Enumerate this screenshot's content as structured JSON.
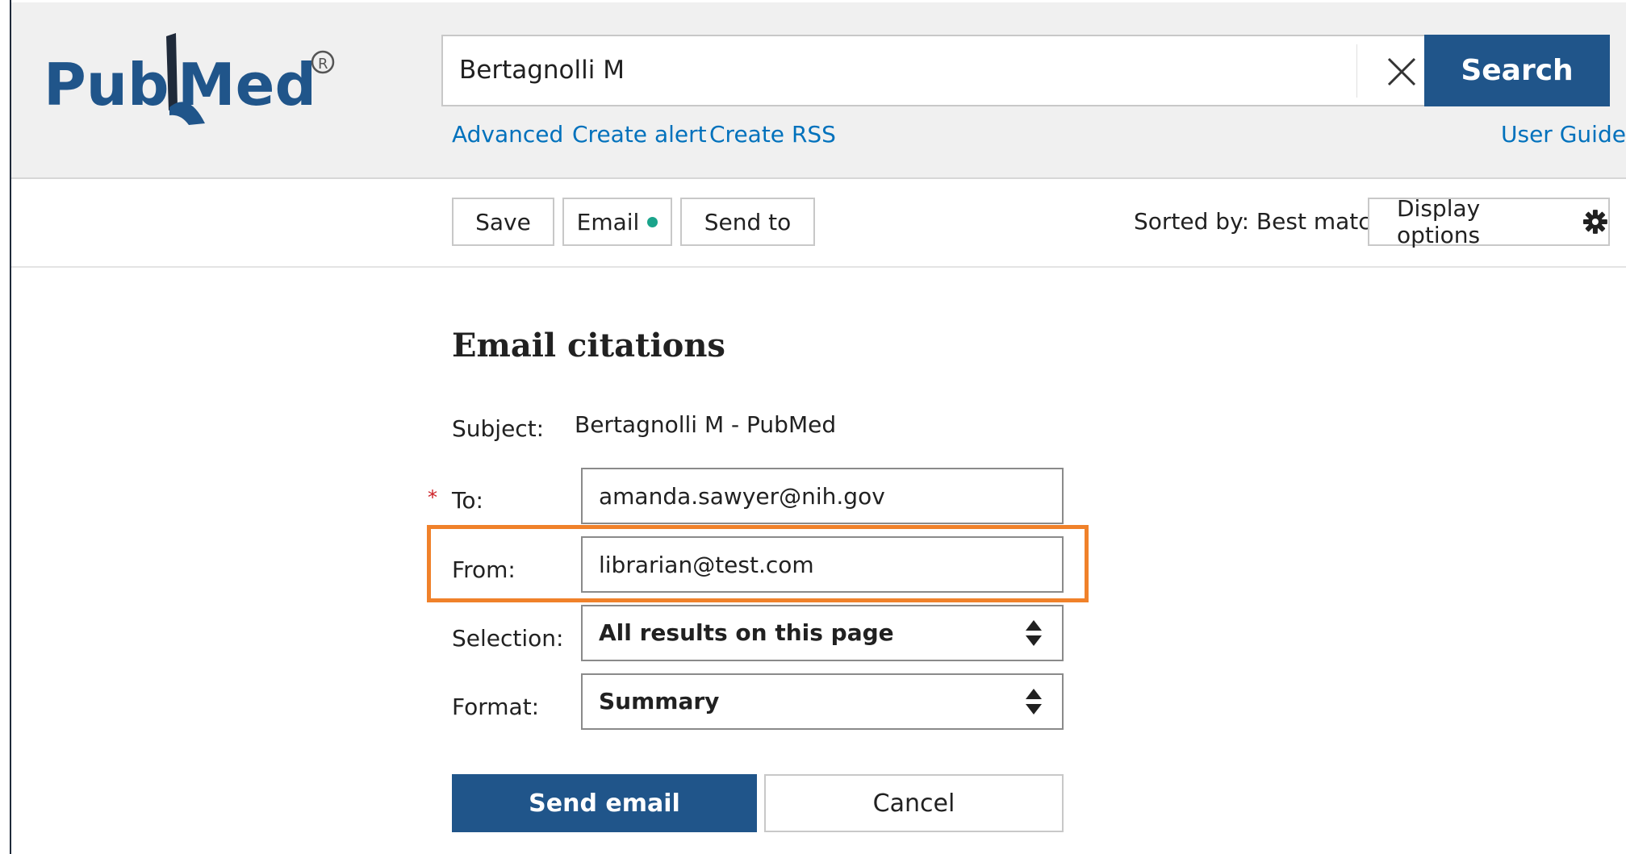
{
  "header": {
    "logo_text": "PubMed",
    "logo_mark": "®",
    "search_value": "Bertagnolli M",
    "search_button": "Search",
    "links": {
      "advanced": "Advanced",
      "create_alert": "Create alert",
      "create_rss": "Create RSS",
      "user_guide": "User Guide"
    }
  },
  "toolbar": {
    "save": "Save",
    "email": "Email",
    "send_to": "Send to",
    "sorted": "Sorted by: Best match",
    "display_options": "Display options"
  },
  "email_form": {
    "title": "Email citations",
    "subject_label": "Subject:",
    "subject_value": "Bertagnolli M - PubMed",
    "required_mark": "*",
    "to_label": "To:",
    "to_value": "amanda.sawyer@nih.gov",
    "from_label": "From:",
    "from_value": "librarian@test.com",
    "selection_label": "Selection:",
    "selection_value": "All results on this page",
    "format_label": "Format:",
    "format_value": "Summary",
    "send_button": "Send email",
    "cancel_button": "Cancel"
  },
  "colors": {
    "brand_blue": "#20558a",
    "link_blue": "#0071bc",
    "highlight_orange": "#f0812a",
    "email_dot": "#1aa48b",
    "required_red": "#cd2026"
  }
}
